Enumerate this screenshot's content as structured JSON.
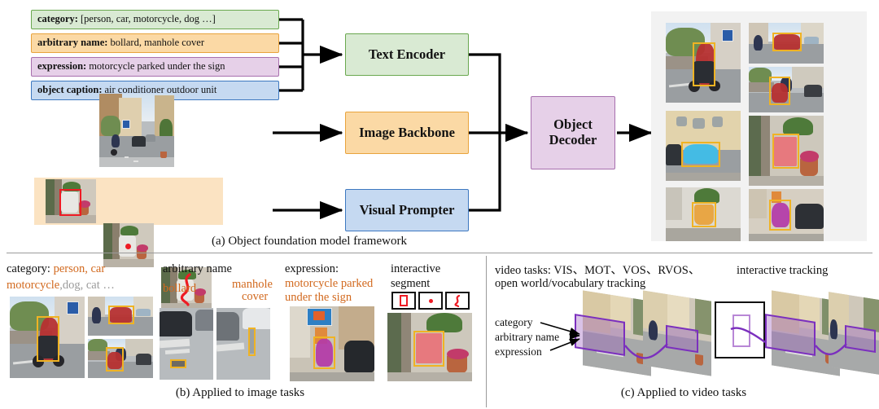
{
  "figure": {
    "panel_a": {
      "caption": "(a) Object foundation model framework",
      "prompts": [
        {
          "key": "category:",
          "value": "[person, car, motorcycle, dog …]",
          "color": "#d9ead3",
          "border": "#6aa84f"
        },
        {
          "key": "arbitrary name:",
          "value": "bollard, manhole cover",
          "color": "#fbd9a5",
          "border": "#e8a33d"
        },
        {
          "key": "expression:",
          "value": "motorcycle parked under the sign",
          "color": "#e6d0e8",
          "border": "#a86fae"
        },
        {
          "key": "object caption:",
          "value": "air conditioner outdoor unit",
          "color": "#c5d9f1",
          "border": "#3d78c0"
        }
      ],
      "modules": [
        {
          "label": "Text Encoder",
          "color": "#d9ead3",
          "border": "#6aa84f"
        },
        {
          "label": "Image Backbone",
          "color": "#fbd9a5",
          "border": "#e8a33d"
        },
        {
          "label": "Visual Prompter",
          "color": "#c5d9f1",
          "border": "#3d78c0"
        }
      ],
      "decoder": {
        "line1": "Object",
        "line2": "Decoder",
        "color": "#e6d0e8",
        "border": "#a86fae"
      }
    },
    "panel_b": {
      "caption": "(b) Applied to image tasks",
      "groups": [
        {
          "head_plain": "category:",
          "head_accent": "person, car",
          "line2_accent": "motorcycle",
          "line2_gray": ",dog, cat …"
        },
        {
          "head_plain": "arbitrary name",
          "term1": "bollard",
          "term2_line1": "manhole",
          "term2_line2": "cover"
        },
        {
          "head_plain": "expression:",
          "accent_line1": "motorcycle parked",
          "accent_line2": "under the sign"
        },
        {
          "head_line1": "interactive",
          "head_line2": "segment",
          "icons": [
            "box-prompt-icon",
            "point-prompt-icon",
            "scribble-prompt-icon"
          ]
        }
      ]
    },
    "panel_c": {
      "caption": "(c) Applied to video tasks",
      "tasks_line1": "video tasks: VIS、MOT、VOS、RVOS、",
      "tasks_line2": "open world/vocabulary tracking",
      "interactive_title": "interactive tracking",
      "arrow_labels": [
        "category",
        "arbitrary name",
        "expression"
      ]
    },
    "colors": {
      "box_yellow": "#f0b323",
      "box_red": "#ee1b24",
      "track_purple": "#7b2fbe",
      "accent_orange": "#d2691e",
      "gray_text": "#9a9a9a"
    }
  }
}
